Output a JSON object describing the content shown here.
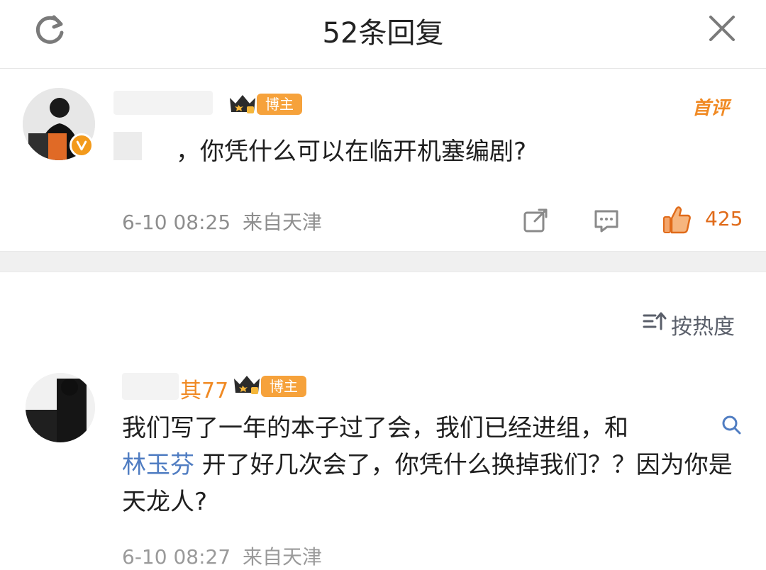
{
  "header": {
    "title": "52条回复",
    "refresh_icon": "refresh-icon",
    "close_icon": "close-icon"
  },
  "comment1": {
    "role_tag": "博主",
    "first_comment_badge": "首评",
    "text": "，你凭什么可以在临开机塞编剧?",
    "timestamp": "6-10 08:25",
    "location": "来自天津",
    "likes": "425",
    "verified_icon": "verified-v-icon",
    "share_icon": "share-icon",
    "comment_icon": "comment-icon",
    "like_icon": "thumbs-up-icon"
  },
  "sort": {
    "label": "按热度",
    "icon": "sort-icon"
  },
  "comment2": {
    "username_suffix": "其77",
    "role_tag": "博主",
    "text_part1": "我们写了一年的本子过了会，我们已经进组，和",
    "mention": "林玉芬",
    "text_part2": " 开了好几次会了，你凭什么换掉我们？？因为你是天龙人?",
    "timestamp": "6-10 08:27",
    "location": "来自天津"
  },
  "colors": {
    "accent_orange": "#f08a24",
    "tag_bg": "#f6a23b",
    "link_blue": "#507dc2",
    "meta_gray": "#8e8e8e",
    "separator": "#f0f0f0"
  }
}
